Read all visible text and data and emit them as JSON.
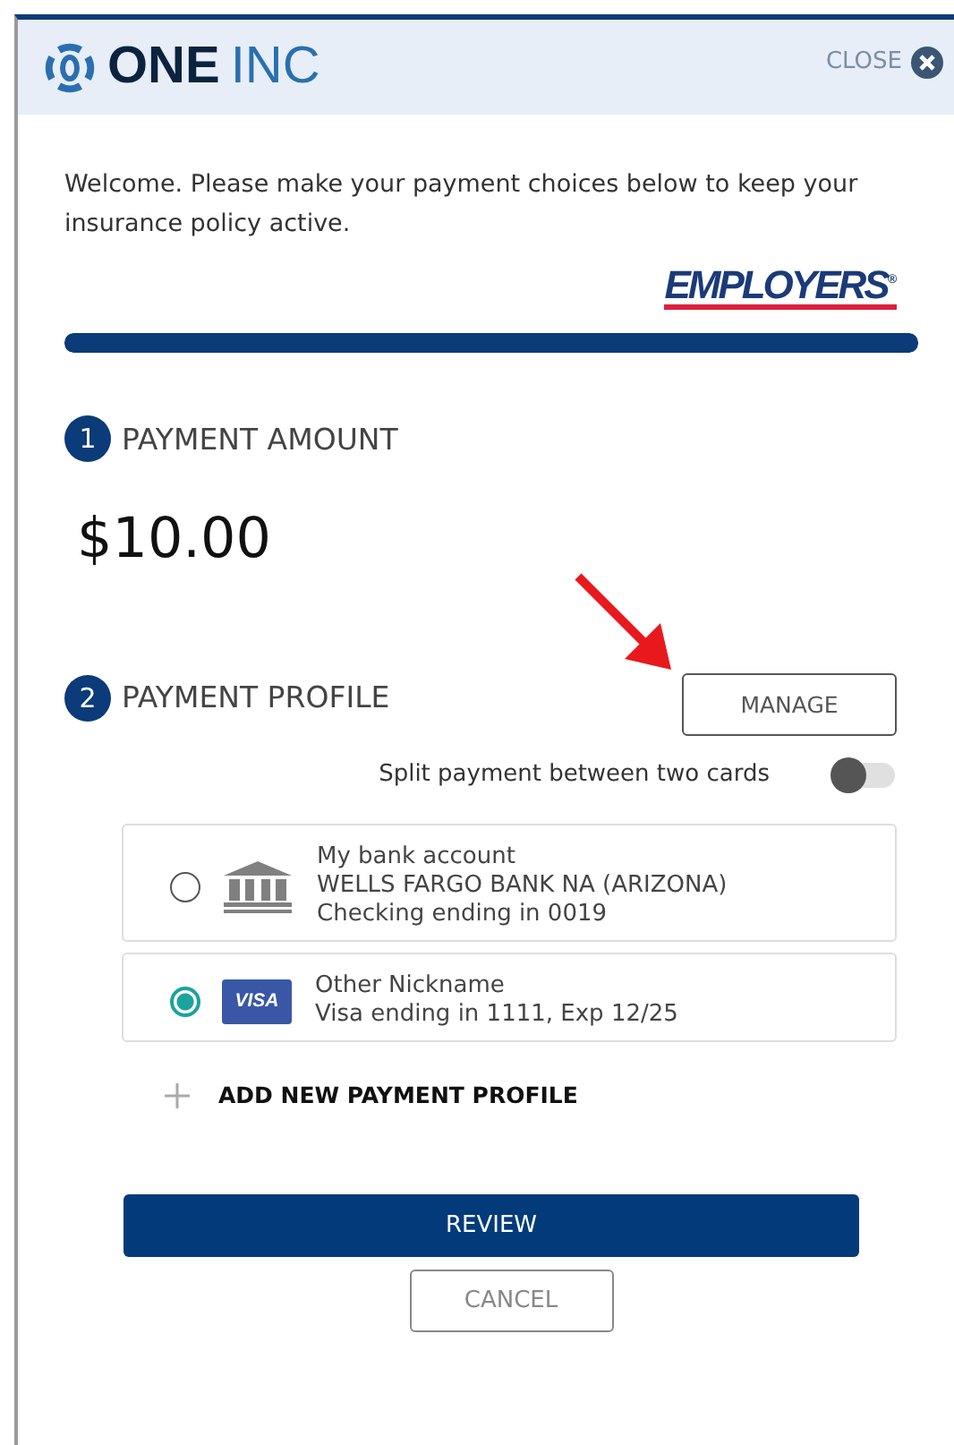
{
  "header": {
    "logo_bold": "ONE",
    "logo_light": "INC",
    "close": "CLOSE"
  },
  "welcome": "Welcome. Please make your payment choices below to keep your insurance policy active.",
  "brand": "EMPLOYERS",
  "brand_mark": "®",
  "progress": {
    "level": 1
  },
  "sections": [
    {
      "number": "1",
      "title": "PAYMENT AMOUNT"
    },
    {
      "number": "2",
      "title": "PAYMENT PROFILE"
    }
  ],
  "amount": "$10.00",
  "manage_button": "MANAGE",
  "split": {
    "label": "Split payment between two cards",
    "on": false
  },
  "profiles": [
    {
      "kind": "bank",
      "selected": false,
      "lines": [
        "My bank account",
        "WELLS FARGO BANK NA (ARIZONA)",
        "Checking ending in 0019"
      ]
    },
    {
      "kind": "card",
      "selected": true,
      "badge": "VISA",
      "lines": [
        "Other Nickname",
        "Visa ending in 1111, Exp 12/25"
      ]
    }
  ],
  "add_profile": "ADD NEW PAYMENT PROFILE",
  "buttons": {
    "primary": "REVIEW",
    "secondary": "CANCEL"
  }
}
